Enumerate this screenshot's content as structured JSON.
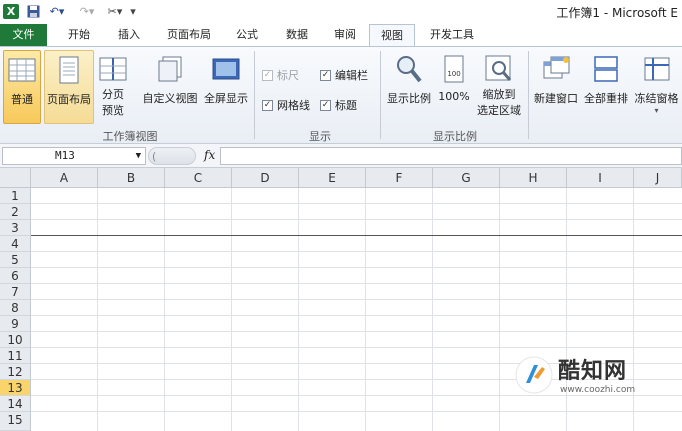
{
  "titlebar": {
    "title": "工作簿1 - Microsoft E"
  },
  "tabs": [
    {
      "label": "文件"
    },
    {
      "label": "开始"
    },
    {
      "label": "插入"
    },
    {
      "label": "页面布局"
    },
    {
      "label": "公式"
    },
    {
      "label": "数据"
    },
    {
      "label": "审阅"
    },
    {
      "label": "视图"
    },
    {
      "label": "开发工具"
    }
  ],
  "ribbon": {
    "workbook_views": {
      "label": "工作簿视图",
      "normal": "普通",
      "page_layout": "页面布局",
      "page_break_line1": "分页",
      "page_break_line2": "预览",
      "custom_view": "自定义视图",
      "full_screen": "全屏显示"
    },
    "show": {
      "label": "显示",
      "ruler": "标尺",
      "formula_bar": "编辑栏",
      "gridlines": "网格线",
      "headings": "标题"
    },
    "zoom": {
      "label": "显示比例",
      "zoom": "显示比例",
      "hundred": "100%",
      "zoom_sel_line1": "缩放到",
      "zoom_sel_line2": "选定区域"
    },
    "window": {
      "new_window": "新建窗口",
      "arrange_all": "全部重排",
      "freeze_panes": "冻结窗格"
    }
  },
  "formula": {
    "name_box": "M13",
    "fx": "fx"
  },
  "grid": {
    "columns": [
      "A",
      "B",
      "C",
      "D",
      "E",
      "F",
      "G",
      "H",
      "I",
      "J"
    ],
    "rows": [
      "1",
      "2",
      "3",
      "4",
      "5",
      "6",
      "7",
      "8",
      "9",
      "10",
      "11",
      "12",
      "13",
      "14",
      "15"
    ],
    "selected_row": "13"
  },
  "watermark": {
    "brand": "酷知网",
    "url": "www.coozhi.com"
  }
}
